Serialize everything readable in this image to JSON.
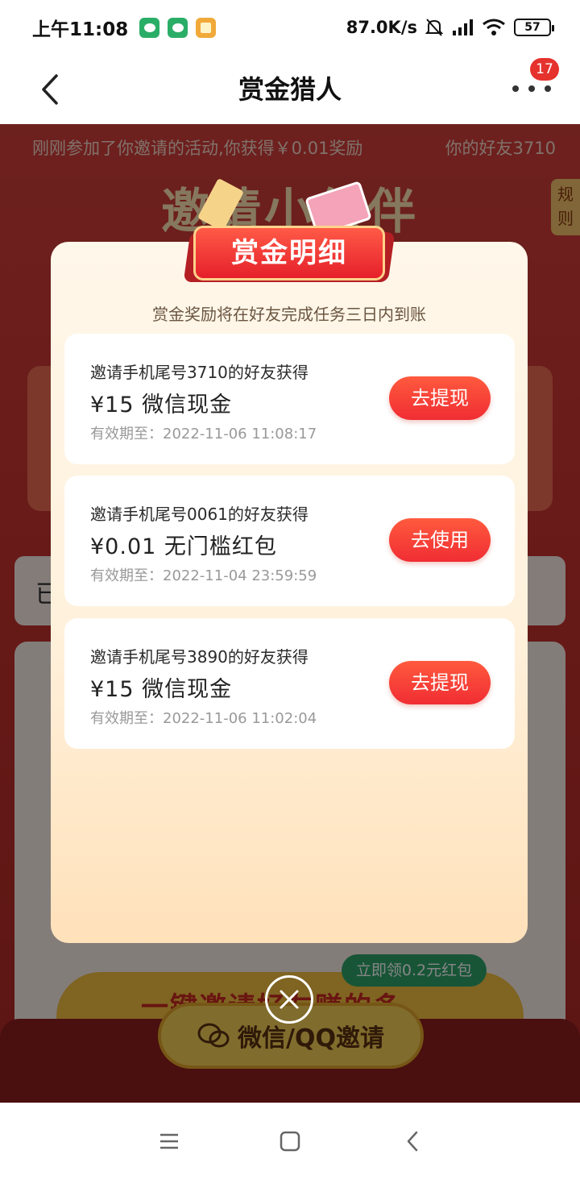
{
  "status_bar": {
    "time": "上午11:08",
    "net_speed": "87.0K/s",
    "battery": "57",
    "app_icons": [
      "wechat-icon",
      "wechat-icon",
      "notes-icon"
    ]
  },
  "nav": {
    "title": "赏金猎人",
    "badge": "17"
  },
  "background": {
    "ticker_left": "刚刚参加了你邀请的活动,你获得￥0.01奖励",
    "ticker_right": "你的好友3710",
    "headline": "邀请小伙伴",
    "rules": "规则",
    "row_text": "已",
    "chip": "立即领0.2元红包",
    "cta_text": "一键邀请好友赚的多",
    "invite_button": "微信/QQ邀请"
  },
  "modal": {
    "title": "赏金明细",
    "subtitle": "赏金奖励将在好友完成任务三日内到账",
    "rewards": [
      {
        "title": "邀请手机尾号3710的好友获得",
        "amount": "¥15 微信现金",
        "expiry": "有效期至：2022-11-06 11:08:17",
        "button": "去提现"
      },
      {
        "title": "邀请手机尾号0061的好友获得",
        "amount": "¥0.01 无门槛红包",
        "expiry": "有效期至：2022-11-04 23:59:59",
        "button": "去使用"
      },
      {
        "title": "邀请手机尾号3890的好友获得",
        "amount": "¥15 微信现金",
        "expiry": "有效期至：2022-11-06 11:02:04",
        "button": "去提现"
      }
    ]
  },
  "colors": {
    "accent_red": "#f02d33",
    "modal_bg": "#fff1dc",
    "background_red": "#c8342f"
  }
}
